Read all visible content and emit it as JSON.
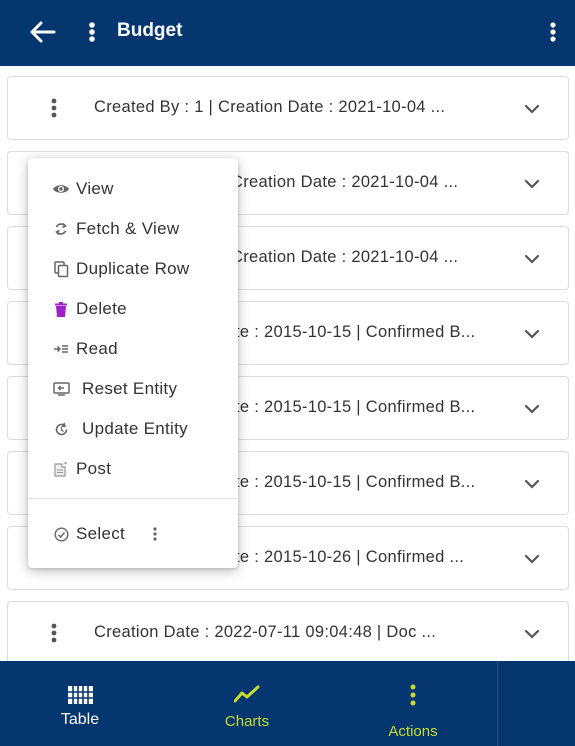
{
  "header": {
    "title": "Budget"
  },
  "rows": [
    {
      "text": "Created By  : 1 | Creation Date  : 2021-10-04 ..."
    },
    {
      "text": "Creation Date  : 2021-10-04 ..."
    },
    {
      "text": "Creation Date  : 2021-10-04 ..."
    },
    {
      "text": "te  : 2015-10-15 | Confirmed B..."
    },
    {
      "text": "te  : 2015-10-15 | Confirmed B..."
    },
    {
      "text": "te  : 2015-10-15 | Confirmed B..."
    },
    {
      "text": "te  : 2015-10-26 | Confirmed ..."
    },
    {
      "text": "Creation Date  : 2022-07-11 09:04:48 | Doc ..."
    }
  ],
  "context_menu": {
    "items": [
      {
        "label": "View",
        "icon": "eye-icon"
      },
      {
        "label": "Fetch & View",
        "icon": "sync-icon"
      },
      {
        "label": "Duplicate Row",
        "icon": "copy-icon"
      },
      {
        "label": "Delete",
        "icon": "trash-icon"
      },
      {
        "label": "Read",
        "icon": "read-icon"
      },
      {
        "label": "Reset Entity",
        "icon": "reset-icon"
      },
      {
        "label": "Update Entity",
        "icon": "update-icon"
      },
      {
        "label": "Post",
        "icon": "post-icon"
      }
    ],
    "select_label": "Select"
  },
  "bottom_nav": {
    "table_label": "Table",
    "charts_label": "Charts",
    "actions_label": "Actions"
  },
  "colors": {
    "primary": "#063670",
    "accent": "#c6dd2e",
    "delete": "#a020c8",
    "icon": "#666666"
  }
}
